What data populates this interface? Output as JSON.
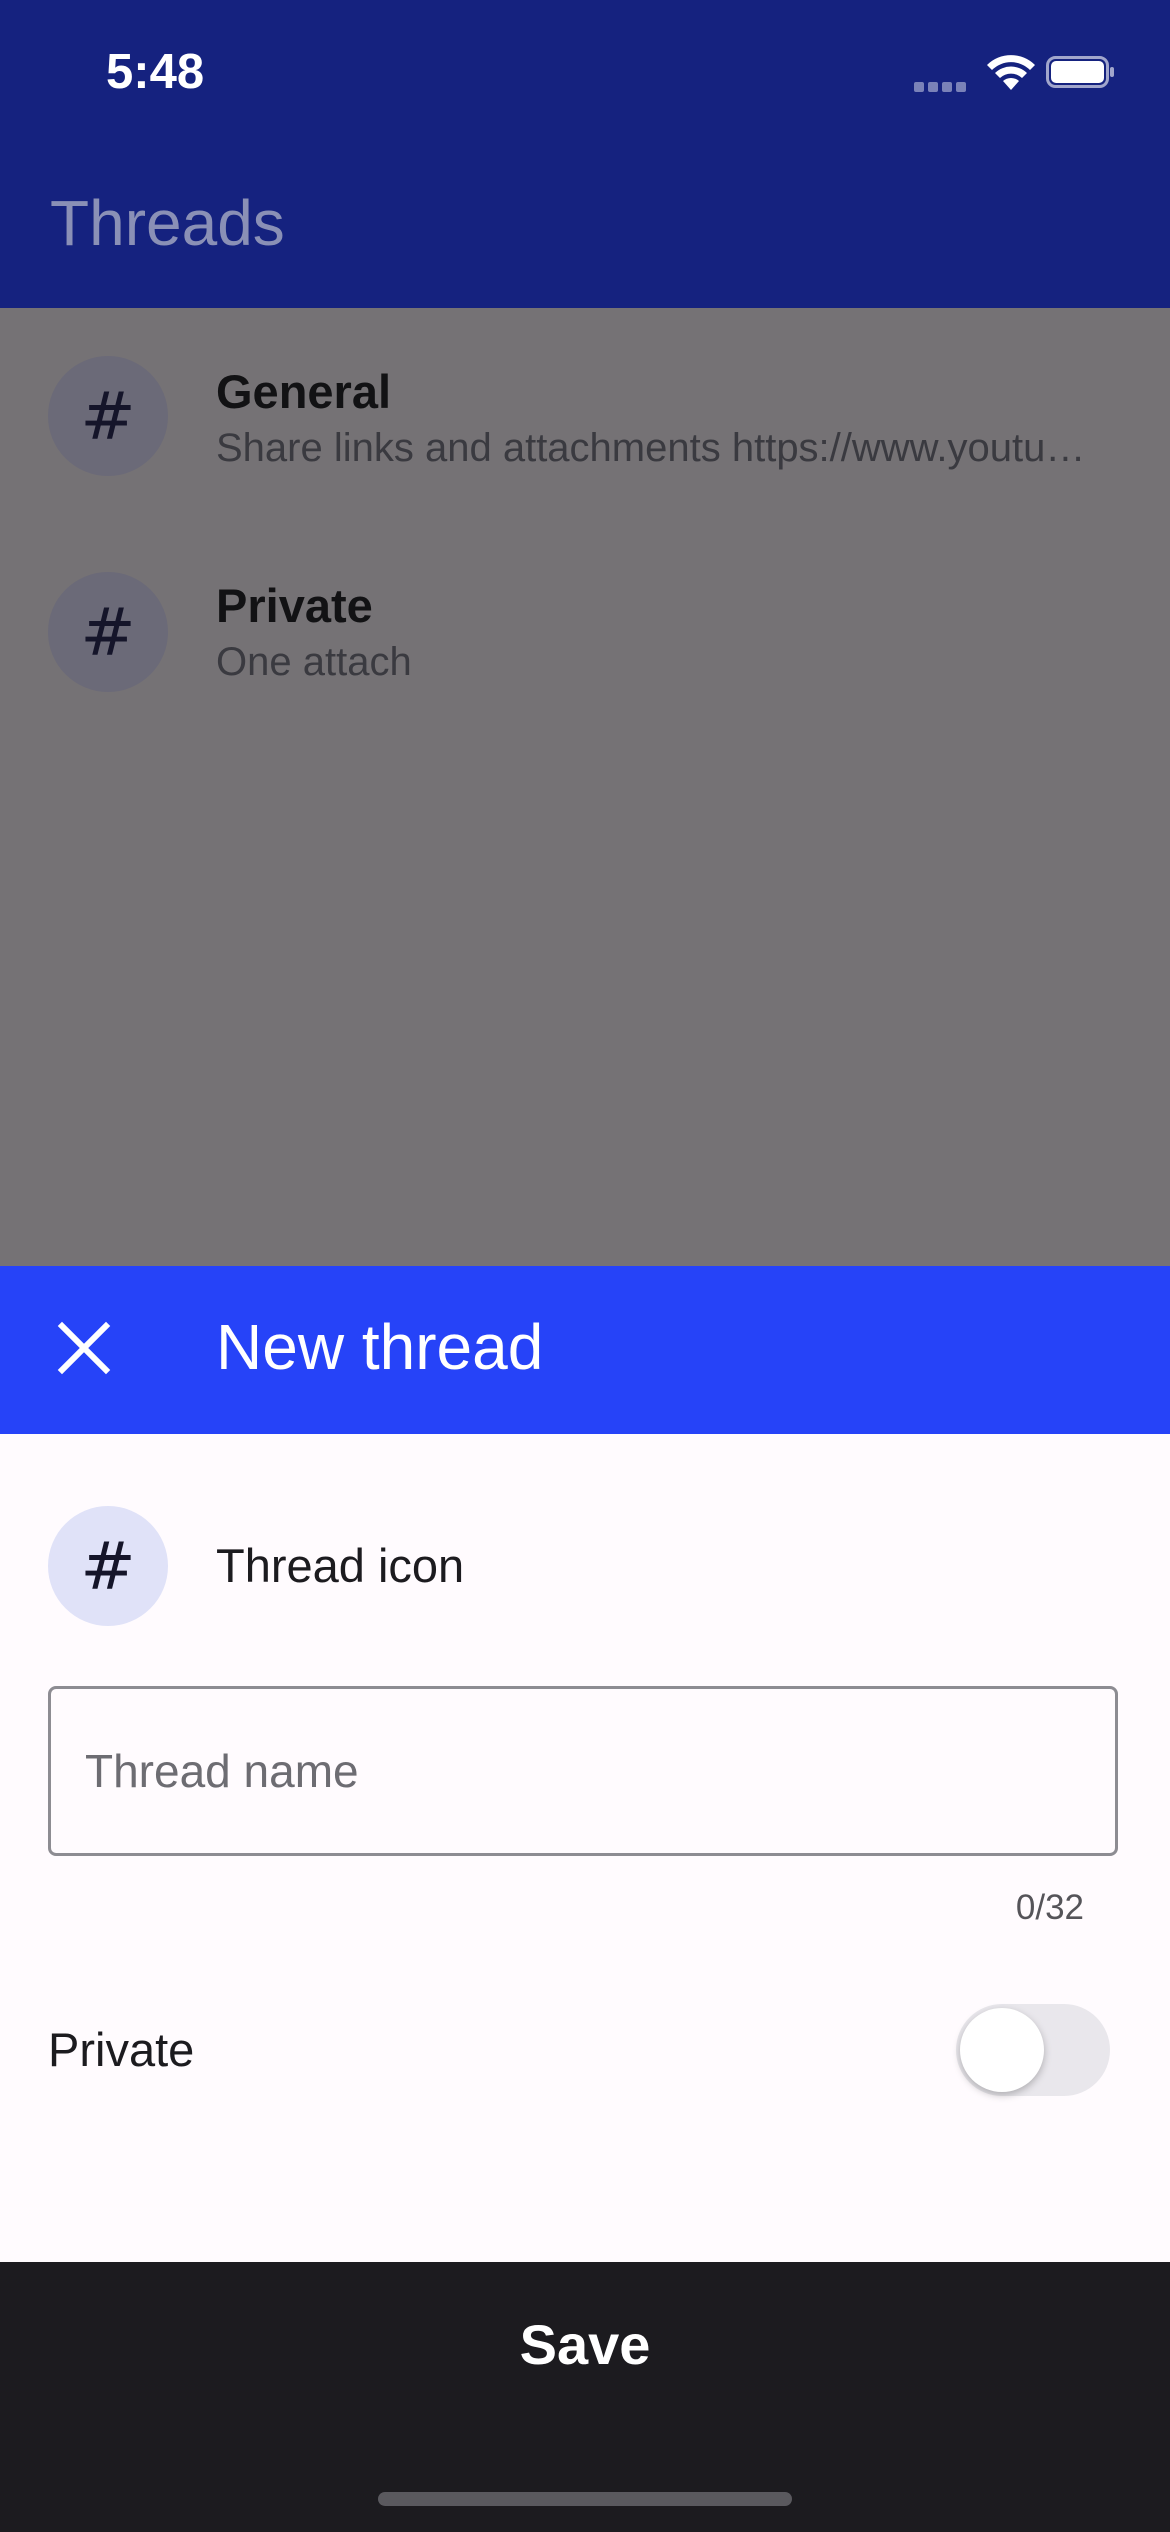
{
  "status_bar": {
    "time": "5:48"
  },
  "app_bar": {
    "title": "Threads"
  },
  "threads": [
    {
      "icon": "#",
      "name": "General",
      "preview": "Share links and attachments https://www.youtube.com"
    },
    {
      "icon": "#",
      "name": "Private",
      "preview": "One attach"
    }
  ],
  "new_thread_sheet": {
    "title": "New thread",
    "icon_glyph": "#",
    "icon_label": "Thread icon",
    "name_field": {
      "value": "",
      "placeholder": "Thread name"
    },
    "counter": "0/32",
    "private_label": "Private",
    "private_enabled": false,
    "save_label": "Save"
  },
  "colors": {
    "app_bar": "#15227f",
    "scrim": "#757275",
    "sheet_header": "#2643f8",
    "save_bar": "#1c1b1f"
  }
}
